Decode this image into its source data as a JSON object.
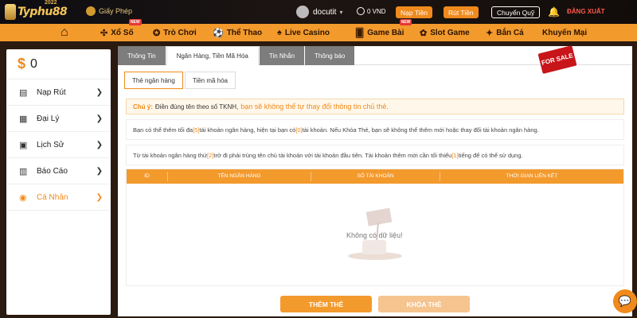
{
  "brand": {
    "name": "Typhu88",
    "year": "2022",
    "license_label": "Giấy Phép"
  },
  "user": {
    "username": "docutit",
    "balance": "0 VND",
    "deposit_label": "Nạp Tiền",
    "withdraw_label": "Rút Tiền",
    "transfer_label": "Chuyển Quỹ",
    "logout_label": "ĐĂNG XUẤT"
  },
  "nav": {
    "items": [
      {
        "label": "Xổ Số",
        "new": "NEW"
      },
      {
        "label": "Trò Chơi",
        "new": ""
      },
      {
        "label": "Thể Thao",
        "new": ""
      },
      {
        "label": "Live Casino",
        "new": ""
      },
      {
        "label": "Game Bài",
        "new": "NEW"
      },
      {
        "label": "Slot Game",
        "new": ""
      },
      {
        "label": "Bắn Cá",
        "new": ""
      },
      {
        "label": "Khuyến Mại",
        "new": ""
      }
    ]
  },
  "sidebar": {
    "currency": "$",
    "amount": "0",
    "items": [
      {
        "label": "Nạp Rút"
      },
      {
        "label": "Đại Lý"
      },
      {
        "label": "Lịch Sử"
      },
      {
        "label": "Báo Cáo"
      },
      {
        "label": "Cá Nhân"
      }
    ]
  },
  "tabs": [
    "Thông Tin",
    "Ngân Hàng, Tiền Mã Hóa",
    "Tin Nhắn",
    "Thông báo"
  ],
  "sale_badge": "FOR SALE",
  "subtabs": [
    "Thẻ ngân hàng",
    "Tiền mã hóa"
  ],
  "note": {
    "label": "Chú ý:",
    "text": "Điền đúng tên theo số TKNH,",
    "emphasis": "bạn sẽ không thể tự thay đổi thông tin chủ thẻ."
  },
  "info1": {
    "a": "Bạn có thể thêm tối đa ",
    "max": "[5]",
    "b": " tài khoản ngân hàng, hiện tại bạn có ",
    "current": "[0]",
    "c": " tài khoản. Nếu Khóa Thẻ, bạn sẽ không thể thêm mới hoặc thay đổi tài khoản ngân hàng."
  },
  "info2": {
    "a": "Từ tài khoản ngân hàng thứ ",
    "n": "[2]",
    "b": " trở đi phải trùng tên chủ tài khoản với tài khoản đầu tiên. Tài khoản thêm mới cần tối thiểu ",
    "m": "[1]",
    "c": " tiếng để có thể sử dụng."
  },
  "table": {
    "headers": [
      "ID",
      "TÊN NGÂN HÀNG",
      "SỐ TÀI KHOẢN",
      "THỜI GIAN LIÊN KẾT"
    ],
    "empty_text": "Không có dữ liệu!"
  },
  "actions": {
    "add_label": "THÊM THẺ",
    "lock_label": "KHÓA THẺ"
  },
  "colors": {
    "accent": "#f39a2d",
    "deposit": "#f08a1c",
    "logout": "#ff5a4a"
  }
}
